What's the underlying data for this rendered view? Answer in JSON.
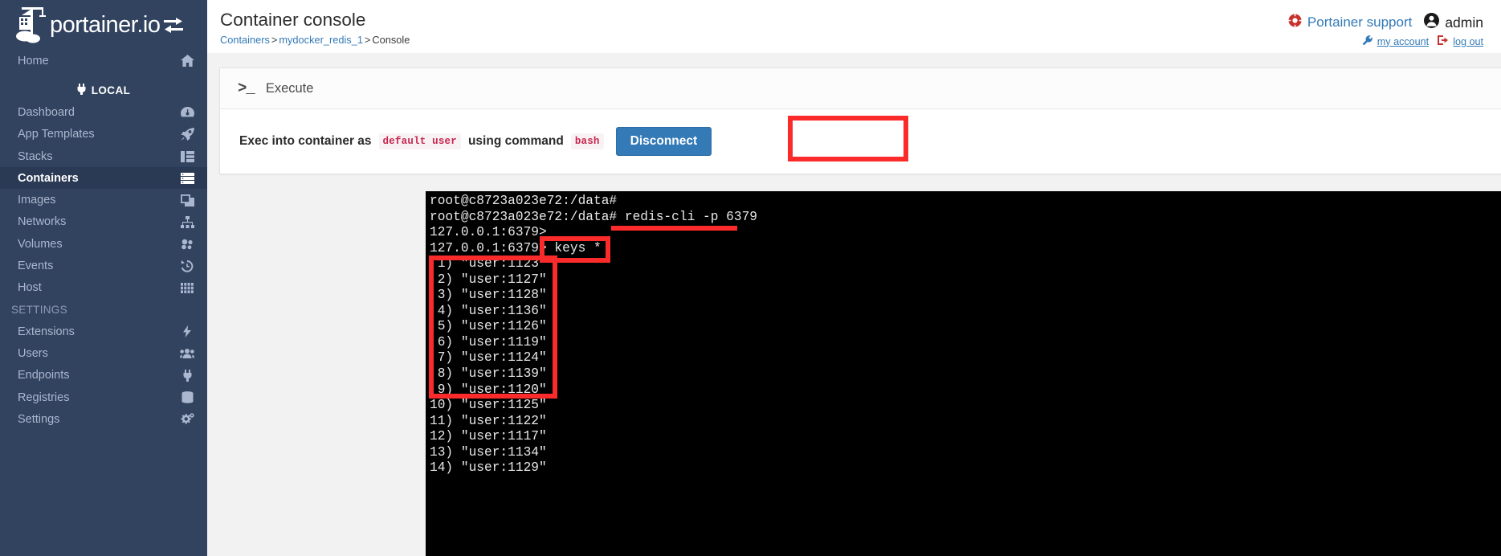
{
  "brand": {
    "name": "portainer.io",
    "toggle_icon": "exchange-arrows-icon"
  },
  "sidebar": {
    "items": [
      {
        "label": "Home",
        "icon": "home-icon",
        "active": false,
        "type": "item"
      }
    ],
    "local_section": {
      "label": "LOCAL",
      "icon": "plug-icon"
    },
    "local_items": [
      {
        "label": "Dashboard",
        "icon": "dashboard-icon",
        "active": false
      },
      {
        "label": "App Templates",
        "icon": "rocket-icon",
        "active": false
      },
      {
        "label": "Stacks",
        "icon": "stacks-icon",
        "active": false
      },
      {
        "label": "Containers",
        "icon": "containers-icon",
        "active": true
      },
      {
        "label": "Images",
        "icon": "images-icon",
        "active": false
      },
      {
        "label": "Networks",
        "icon": "sitemap-icon",
        "active": false
      },
      {
        "label": "Volumes",
        "icon": "volumes-icon",
        "active": false
      },
      {
        "label": "Events",
        "icon": "history-icon",
        "active": false
      },
      {
        "label": "Host",
        "icon": "grid-icon",
        "active": false
      }
    ],
    "settings_section": {
      "label": "SETTINGS"
    },
    "settings_items": [
      {
        "label": "Extensions",
        "icon": "bolt-icon",
        "active": false
      },
      {
        "label": "Users",
        "icon": "users-icon",
        "active": false
      },
      {
        "label": "Endpoints",
        "icon": "plug-icon",
        "active": false
      },
      {
        "label": "Registries",
        "icon": "database-icon",
        "active": false
      },
      {
        "label": "Settings",
        "icon": "gears-icon",
        "active": false
      }
    ]
  },
  "header": {
    "title": "Container console",
    "breadcrumb": {
      "root": "Containers",
      "sep1": ">",
      "container": "mydocker_redis_1",
      "sep2": ">",
      "current": "Console"
    },
    "support_label": "Portainer support",
    "support_icon": "life-ring-icon",
    "user_label": "admin",
    "user_icon": "user-circle-icon",
    "my_account_label": "my account",
    "my_account_icon": "wrench-icon",
    "logout_label": "log out",
    "logout_icon": "sign-out-icon"
  },
  "panel": {
    "title": "Execute",
    "prompt_icon": ">_",
    "exec_prefix": "Exec into container as",
    "user_code": "default user",
    "exec_middle": "using command",
    "command_code": "bash",
    "disconnect_label": "Disconnect"
  },
  "terminal": {
    "lines": [
      "root@c8723a023e72:/data#",
      "root@c8723a023e72:/data# redis-cli -p 6379",
      "127.0.0.1:6379>",
      "127.0.0.1:6379> keys *",
      " 1) \"user:1123\"",
      " 2) \"user:1127\"",
      " 3) \"user:1128\"",
      " 4) \"user:1136\"",
      " 5) \"user:1126\"",
      " 6) \"user:1119\"",
      " 7) \"user:1124\"",
      " 8) \"user:1139\"",
      " 9) \"user:1120\"",
      "10) \"user:1125\"",
      "11) \"user:1122\"",
      "12) \"user:1117\"",
      "13) \"user:1134\"",
      "14) \"user:1129\""
    ]
  },
  "annotations": {
    "color": "#fb2b2b",
    "items": [
      {
        "name": "disconnect-button-highlight",
        "shape": "box"
      },
      {
        "name": "redis-cli-command-underline",
        "shape": "bar"
      },
      {
        "name": "keys-command-highlight",
        "shape": "box"
      },
      {
        "name": "keys-result-highlight",
        "shape": "box"
      }
    ]
  }
}
